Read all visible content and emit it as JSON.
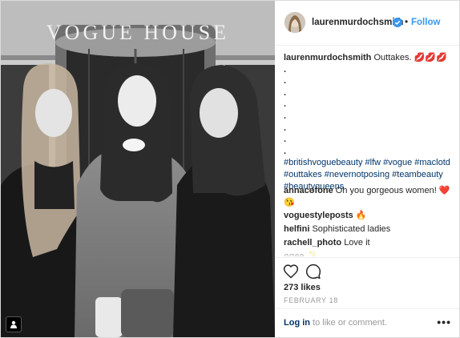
{
  "post": {
    "username": "laurenmurdochsmith",
    "follow_label": "Follow",
    "separator": "•",
    "caption_text": "Outtakes. 💋💋💋",
    "caption_dots": [
      ".",
      ".",
      ".",
      ".",
      ".",
      ".",
      ".",
      "."
    ],
    "hashtags": "#britishvoguebeauty #lfw #vogue #maclotd #outtakes #nevernotposing #teambeauty #beautyqueens"
  },
  "photo": {
    "sign_text": "VOGUE HOUSE"
  },
  "comments": [
    {
      "user": "annacofone",
      "text": "Oh you gorgeous women! ❤️😘"
    },
    {
      "user": "voguestyleposts",
      "text": "🔥"
    },
    {
      "user": "helfini",
      "text": "Sophisticated ladies"
    },
    {
      "user": "rachell_photo",
      "text": "Love it"
    },
    {
      "user": "ogee",
      "text": "✨"
    }
  ],
  "stats": {
    "likes": "273 likes",
    "date": "FEBRUARY 18"
  },
  "login": {
    "link": "Log in",
    "rest": " to like or comment.",
    "more": "•••"
  },
  "icons": {
    "like": "heart-icon",
    "comment": "comment-icon",
    "verified": "verified-badge-icon",
    "more": "more-options-icon",
    "photo_corner": "user-tag-icon"
  },
  "colors": {
    "link": "#3897f0",
    "hashtag": "#003569",
    "muted": "#999999"
  }
}
